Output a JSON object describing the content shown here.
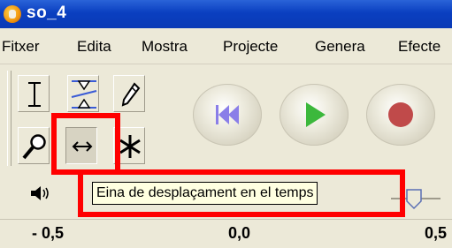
{
  "window": {
    "title": "so_4"
  },
  "menu": [
    "Fitxer",
    "Edita",
    "Mostra",
    "Projecte",
    "Genera",
    "Efecte"
  ],
  "tools": [
    {
      "name": "selection-tool-icon",
      "active": false
    },
    {
      "name": "envelope-tool-icon",
      "active": false
    },
    {
      "name": "draw-tool-icon",
      "active": false
    },
    {
      "name": "zoom-tool-icon",
      "active": false
    },
    {
      "name": "time-shift-tool-icon",
      "active": true
    },
    {
      "name": "multi-tool-icon",
      "active": false
    }
  ],
  "transport": [
    "skip-to-start-icon",
    "play-icon",
    "record-icon"
  ],
  "tooltip": {
    "text": "Eina de desplaçament en el temps"
  },
  "ruler": {
    "labels": [
      "- 0,5",
      "0,0",
      "0,5"
    ]
  },
  "colors": {
    "highlight": "#ff0000",
    "titlebar": "#0a3fc0",
    "play": "#3cb83c",
    "record": "#c04a4a",
    "skip": "#8a7ee8"
  }
}
